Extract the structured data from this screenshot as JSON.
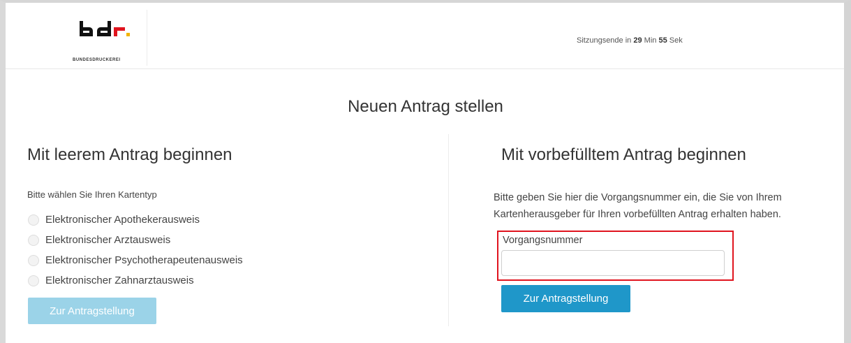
{
  "brand": {
    "logo_text": "bdr.",
    "logo_subtext": "BUNDESDRUCKEREI",
    "colors": {
      "logo_dark": "#111111",
      "logo_red": "#e0141e",
      "logo_gold": "#f2b400"
    }
  },
  "header": {
    "session_prefix": "Sitzungsende in",
    "session_minutes": "29",
    "session_min_label": "Min",
    "session_seconds": "55",
    "session_sec_label": "Sek"
  },
  "page": {
    "title": "Neuen Antrag stellen"
  },
  "left": {
    "title": "Mit leerem Antrag beginnen",
    "hint": "Bitte wählen Sie Ihren Kartentyp",
    "options": [
      "Elektronischer Apothekerausweis",
      "Elektronischer Arztausweis",
      "Elektronischer Psychotherapeutenausweis",
      "Elektronischer Zahnarztausweis"
    ],
    "button_label": "Zur Antragstellung"
  },
  "right": {
    "title": "Mit vorbefülltem Antrag beginnen",
    "hint_line1": "Bitte geben Sie hier die Vorgangsnummer ein, die Sie von Ihrem",
    "hint_line2": "Kartenherausgeber für Ihren vorbefüllten Antrag erhalten haben.",
    "field_label": "Vorgangsnummer",
    "field_value": "",
    "button_label": "Zur Antragstellung"
  }
}
